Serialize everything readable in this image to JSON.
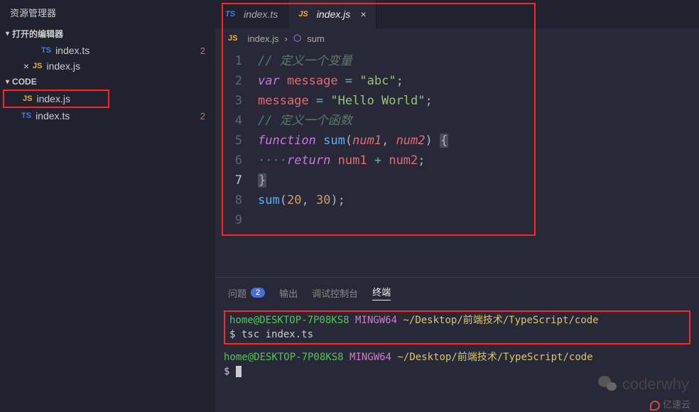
{
  "sidebar": {
    "title": "资源管理器",
    "open_editors": {
      "label": "打开的编辑器",
      "items": [
        {
          "icon": "TS",
          "name": "index.ts",
          "badge": "2",
          "closable": false
        },
        {
          "icon": "JS",
          "name": "index.js",
          "badge": "",
          "closable": true
        }
      ]
    },
    "workspace": {
      "label": "CODE",
      "items": [
        {
          "icon": "JS",
          "name": "index.js",
          "badge": "",
          "highlighted": true
        },
        {
          "icon": "TS",
          "name": "index.ts",
          "badge": "2",
          "highlighted": false
        }
      ]
    }
  },
  "tabs": [
    {
      "icon": "TS",
      "name": "index.ts",
      "active": false
    },
    {
      "icon": "JS",
      "name": "index.js",
      "active": true
    }
  ],
  "breadcrumb": {
    "file_icon": "JS",
    "file": "index.js",
    "symbol": "sum"
  },
  "code": {
    "lines": [
      {
        "n": 1,
        "html": "<span class='c-comment'>// 定义一个变量</span>"
      },
      {
        "n": 2,
        "html": "<span class='c-keyword'>var</span> <span class='c-var'>message</span> <span class='c-op'>=</span> <span class='c-string'>\"abc\"</span><span class='c-punct'>;</span>"
      },
      {
        "n": 3,
        "html": "<span class='c-var'>message</span> <span class='c-op'>=</span> <span class='c-string'>\"Hello World\"</span><span class='c-punct'>;</span>"
      },
      {
        "n": 4,
        "html": "<span class='c-comment'>// 定义一个函数</span>"
      },
      {
        "n": 5,
        "html": "<span class='c-keyword'>function</span> <span class='c-func'>sum</span><span class='c-punct'>(</span><span class='c-param'>num1</span><span class='c-punct'>,</span> <span class='c-param'>num2</span><span class='c-punct'>)</span> <span class='c-punct c-brace-hl'>{</span>"
      },
      {
        "n": 6,
        "html": "<span class='c-comment'>····</span><span class='c-keyword'>return</span> <span class='c-var'>num1</span> <span class='c-op'>+</span> <span class='c-var'>num2</span><span class='c-punct'>;</span>"
      },
      {
        "n": 7,
        "html": "<span class='c-punct c-brace-hl'>}</span>",
        "current": true
      },
      {
        "n": 8,
        "html": "<span class='c-func'>sum</span><span class='c-punct'>(</span><span class='c-num'>20</span><span class='c-punct'>,</span> <span class='c-num'>30</span><span class='c-punct'>);</span>"
      },
      {
        "n": 9,
        "html": ""
      }
    ]
  },
  "panel": {
    "tabs": {
      "problems": "问题",
      "problems_count": "2",
      "output": "输出",
      "debug": "调试控制台",
      "terminal": "终端"
    },
    "terminal": {
      "user": "home@DESKTOP-7P08KS8",
      "shell": "MINGW64",
      "path": "~/Desktop/前端技术/TypeScript/code",
      "command": "tsc index.ts",
      "prompt": "$"
    }
  },
  "watermark": "coderwhy",
  "footer_brand": "亿速云"
}
